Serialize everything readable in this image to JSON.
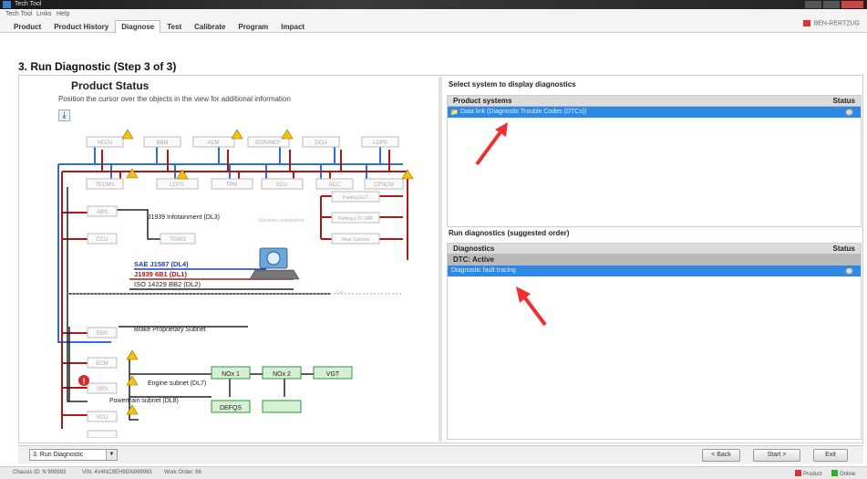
{
  "window": {
    "title": "Tech Tool"
  },
  "menu": {
    "items": [
      "Tech Tool",
      "Links",
      "Help"
    ],
    "user": "BEN-RERTZUG"
  },
  "tabs": [
    "Product",
    "Product History",
    "Diagnose",
    "Test",
    "Calibrate",
    "Program",
    "Impact"
  ],
  "active_tab": "Diagnose",
  "page": {
    "heading": "3. Run Diagnostic (Step 3 of 3)"
  },
  "product_status": {
    "title": "Product Status",
    "hint": "Position the cursor over the objects in the view for additional information",
    "download_icon": "download-icon",
    "diagram": {
      "top_ecus": [
        "VECU",
        "BBM",
        "ACM",
        "EGR/MCF",
        "DCU",
        "LDPS"
      ],
      "second_ecus": [
        "TECMS",
        "LCPS",
        "TPM",
        "SCU",
        "ACC",
        "CPSCM"
      ],
      "left_ecus": [
        "ABS",
        "CCU",
        "EBS",
        "ECM",
        "SRS",
        "VCU"
      ],
      "infotainment_unit": "TGW3",
      "right_units": [
        "Parking ECT",
        "Parking LTV SRF",
        "Rear Camera"
      ],
      "side_caption": "Electronic subsystems",
      "labels": {
        "infotainment": "J1939 Infotainment (DL3)",
        "brake": "Brake Proprietary Subnet",
        "engine": "Engine subnet (DL7)",
        "powertrain": "Powertrain subnet (DL8)",
        "call": "Call"
      },
      "buses": [
        {
          "name": "SAE J1587 (DL4)",
          "color": "#1a3fc4"
        },
        {
          "name": "J1939 6B1 (DL1)",
          "color": "#b01818"
        },
        {
          "name": "ISO 14229 BB2 (DL2)",
          "color": "#222222"
        }
      ],
      "nox": [
        "NOx 1",
        "NOx 2",
        "VGT",
        "DEFQS"
      ],
      "warning_icon": "warning-icon",
      "error_icon": "error-icon",
      "laptop_icon": "laptop-icon"
    }
  },
  "systems": {
    "label": "Select system to display diagnostics",
    "col_name": "Product systems",
    "col_status": "Status",
    "rows": [
      {
        "name": "Data link (Diagnostic Trouble Codes (DTCs))"
      }
    ]
  },
  "run_diag": {
    "label": "Run diagnostics (suggested order)",
    "col_name": "Diagnostics",
    "col_status": "Status",
    "group": "DTC: Active",
    "rows": [
      {
        "name": "Diagnostic fault tracing"
      }
    ]
  },
  "bottom": {
    "step": "3. Run Diagnostic",
    "back": "< Back",
    "start": "Start >",
    "exit": "Exit"
  },
  "statusbar": {
    "chassis": "Chassis ID: N 999993",
    "vin": "VIN: 4V4NC9EH9GN999993",
    "work_order": "Work Order: 86",
    "product": "Product",
    "online": "Online"
  },
  "colors": {
    "selection": "#2d89e6",
    "annotation_arrow": "#f03030",
    "ecu_green": "#2a9a3a"
  }
}
